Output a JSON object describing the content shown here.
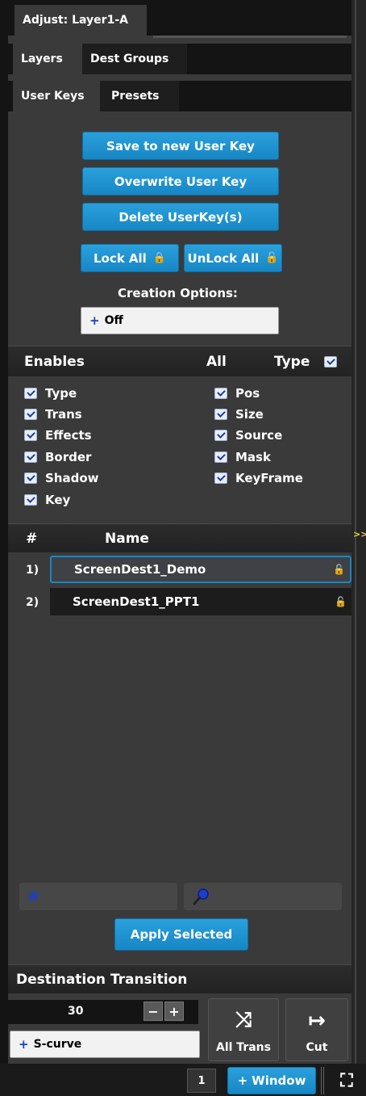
{
  "panel_title": "Adjust: Layer1-A",
  "tabs_top": [
    "Layers",
    "Dest Groups"
  ],
  "tabs_sub": [
    "User Keys",
    "Presets"
  ],
  "buttons": {
    "save_new": "Save to new User Key",
    "overwrite": "Overwrite User Key",
    "delete": "Delete UserKey(s)",
    "lock_all": "Lock All",
    "unlock_all": "UnLock All"
  },
  "creation_options": {
    "label": "Creation Options:",
    "value": "Off"
  },
  "enables": {
    "header": "Enables",
    "all_label": "All",
    "type_label": "Type",
    "left": [
      "Type",
      "Trans",
      "Effects",
      "Border",
      "Shadow",
      "Key"
    ],
    "right": [
      "Pos",
      "Size",
      "Source",
      "Mask",
      "KeyFrame"
    ]
  },
  "list": {
    "col_num": "#",
    "col_name": "Name",
    "rows": [
      {
        "num": "1)",
        "name": "ScreenDest1_Demo"
      },
      {
        "num": "2)",
        "name": "ScreenDest1_PPT1"
      }
    ]
  },
  "filter": {
    "hash_symbol": "#"
  },
  "apply_button": "Apply Selected",
  "destination_transition": {
    "title": "Destination Transition",
    "duration": "30",
    "curve": "S-curve",
    "all_trans": "All Trans",
    "cut": "Cut"
  },
  "footer": {
    "page": "1",
    "window_button": "Window"
  },
  "side_indicator": ">>",
  "colors": {
    "accent_blue": "#1787c4",
    "panel_bg": "#3a3a3a",
    "dark_bg": "#141414"
  }
}
